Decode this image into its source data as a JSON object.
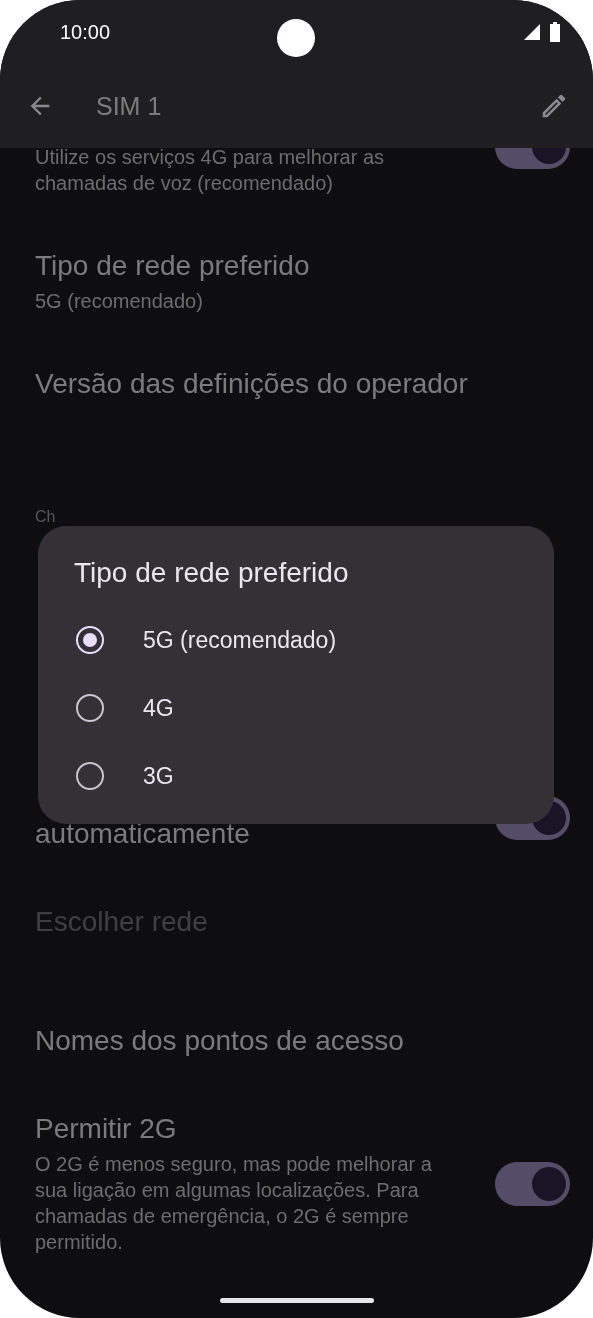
{
  "status_bar": {
    "time": "10:00"
  },
  "app_bar": {
    "title": "SIM 1"
  },
  "settings": [
    {
      "kind": "switch",
      "subtitle": "Utilize os serviços 4G para melhorar as chamadas de voz (recomendado)",
      "on": true,
      "disabled": false
    },
    {
      "kind": "pref",
      "title": "Tipo de rede preferido",
      "subtitle": "5G (recomendado)",
      "disabled": false
    },
    {
      "kind": "pref",
      "title": "Versão das definições do operador",
      "disabled": false
    },
    {
      "kind": "category",
      "title": "Ch",
      "disabled": false
    },
    {
      "kind": "switch",
      "title": "automaticamente",
      "on": true,
      "disabled": false
    },
    {
      "kind": "pref",
      "title": "Escolher rede",
      "disabled": true
    },
    {
      "kind": "pref",
      "title": "Nomes dos pontos de acesso",
      "disabled": false
    },
    {
      "kind": "switch",
      "title": "Permitir 2G",
      "subtitle": "O 2G é menos seguro, mas pode melhorar a sua ligação em algumas localizações. Para chamadas de emergência, o 2G é sempre permitido.",
      "on": true,
      "disabled": false
    }
  ],
  "dialog": {
    "title": "Tipo de rede preferido",
    "options": [
      {
        "label": "5G (recomendado)",
        "selected": true
      },
      {
        "label": "4G",
        "selected": false
      },
      {
        "label": "3G",
        "selected": false
      }
    ]
  }
}
